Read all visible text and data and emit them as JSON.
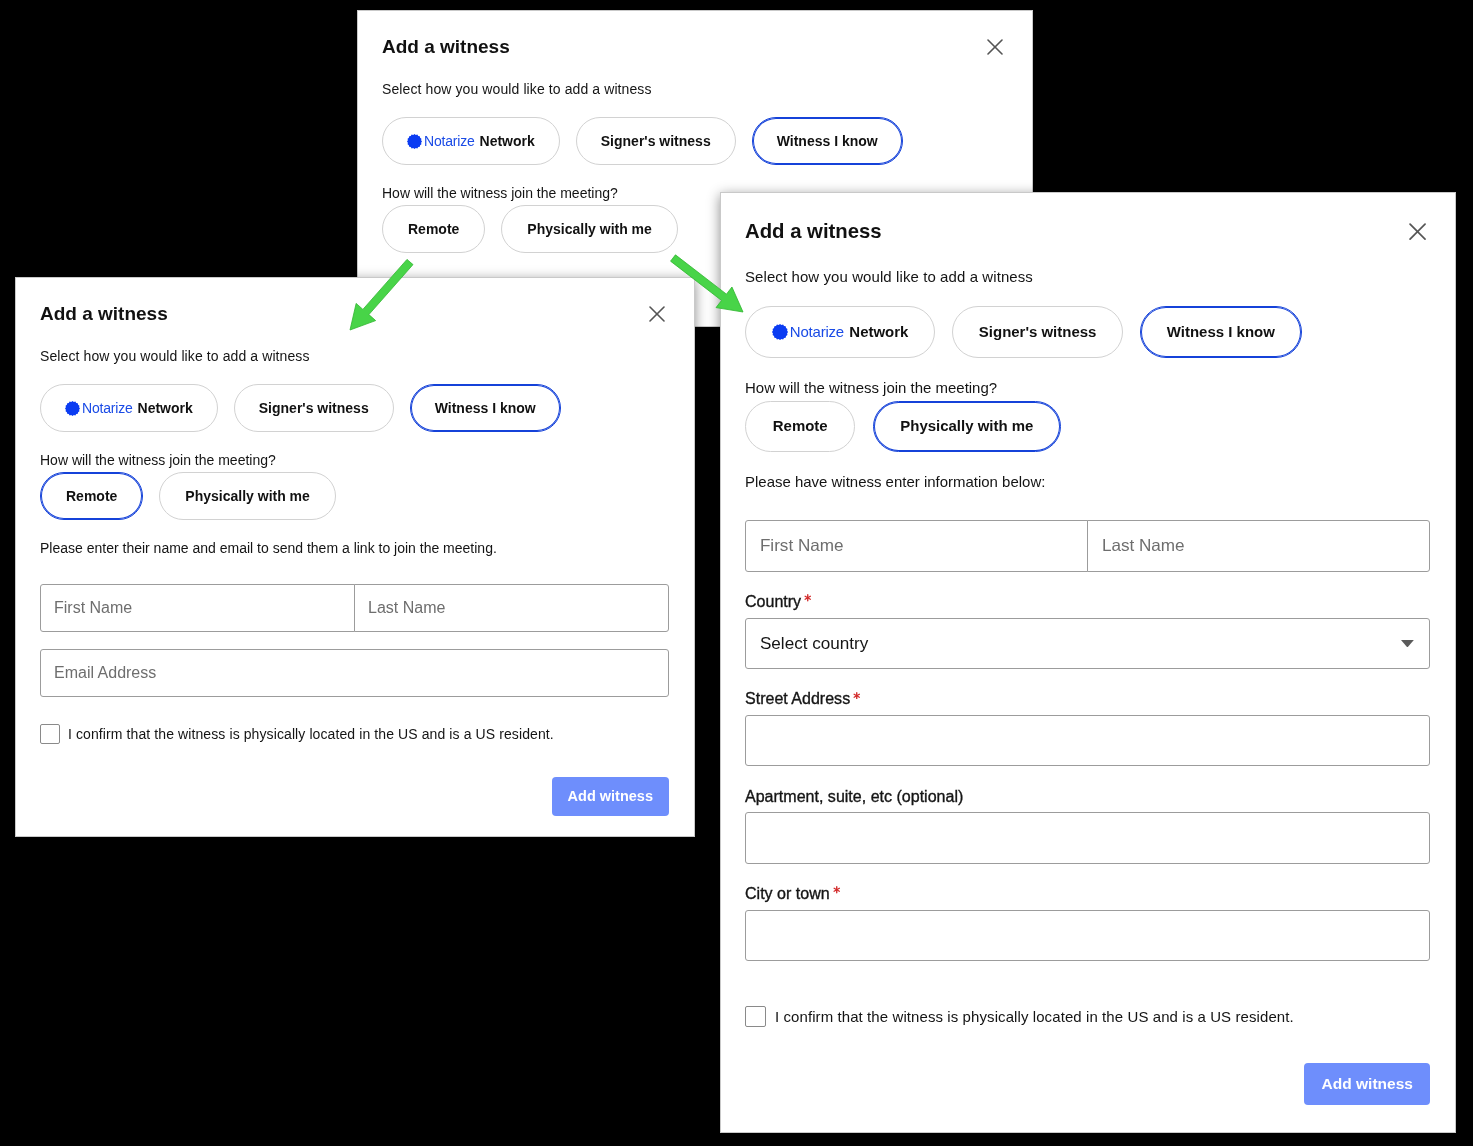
{
  "dialogs": [
    {
      "title": "Add a witness",
      "subtitle": "Select how you would like to add a witness",
      "methods": [
        {
          "kind": "brand",
          "brand": "Notarize",
          "label": "Network",
          "selected": false
        },
        {
          "kind": "plain",
          "label": "Signer's witness",
          "selected": false
        },
        {
          "kind": "plain",
          "label": "Witness I know",
          "selected": true
        }
      ],
      "join_question": "How will the witness join the meeting?",
      "join_options": [
        {
          "label": "Remote",
          "selected": false
        },
        {
          "label": "Physically with me",
          "selected": false
        }
      ]
    },
    {
      "title": "Add a witness",
      "subtitle": "Select how you would like to add a witness",
      "methods": [
        {
          "kind": "brand",
          "brand": "Notarize",
          "label": "Network",
          "selected": false
        },
        {
          "kind": "plain",
          "label": "Signer's witness",
          "selected": false
        },
        {
          "kind": "plain",
          "label": "Witness I know",
          "selected": true
        }
      ],
      "join_question": "How will the witness join the meeting?",
      "join_options": [
        {
          "label": "Remote",
          "selected": true
        },
        {
          "label": "Physically with me",
          "selected": false
        }
      ],
      "instructions": "Please enter their name and email to send them a link to join the meeting.",
      "fields": [
        {
          "kind": "name_pair",
          "first_placeholder": "First Name",
          "last_placeholder": "Last Name"
        },
        {
          "kind": "text",
          "placeholder": "Email Address"
        }
      ],
      "confirmation": {
        "label": "I confirm that the witness is physically located in the US and is a US resident.",
        "checked": false
      },
      "submit": {
        "label": "Add witness",
        "disabled": true
      }
    },
    {
      "title": "Add a witness",
      "subtitle": "Select how you would like to add a witness",
      "methods": [
        {
          "kind": "brand",
          "brand": "Notarize",
          "label": "Network",
          "selected": false
        },
        {
          "kind": "plain",
          "label": "Signer's witness",
          "selected": false
        },
        {
          "kind": "plain",
          "label": "Witness I know",
          "selected": true
        }
      ],
      "join_question": "How will the witness join the meeting?",
      "join_options": [
        {
          "label": "Remote",
          "selected": false
        },
        {
          "label": "Physically with me",
          "selected": true
        }
      ],
      "instructions": "Please have witness enter information below:",
      "fields": [
        {
          "kind": "name_pair",
          "first_placeholder": "First Name",
          "last_placeholder": "Last Name"
        },
        {
          "kind": "select",
          "label": "Country",
          "required": true,
          "value": "Select country"
        },
        {
          "kind": "text",
          "label": "Street Address",
          "required": true
        },
        {
          "kind": "text",
          "label": "Apartment, suite, etc (optional)",
          "required": false
        },
        {
          "kind": "text",
          "label": "City or town",
          "required": true
        }
      ],
      "confirmation": {
        "label": "I confirm that the witness is physically located in the US and is a US resident.",
        "checked": false
      },
      "submit": {
        "label": "Add witness",
        "disabled": true
      }
    }
  ]
}
